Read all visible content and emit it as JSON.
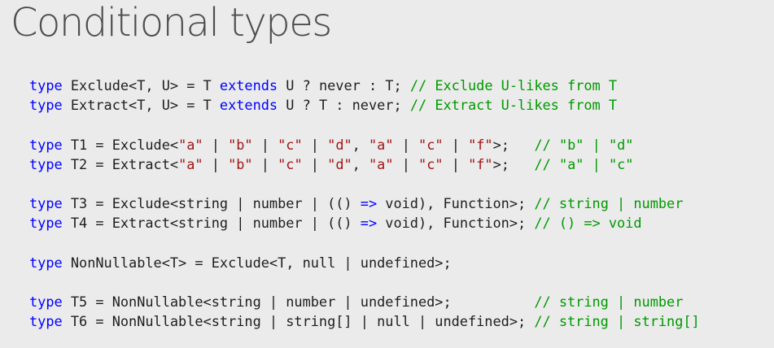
{
  "slide": {
    "title": "Conditional types"
  },
  "code_groups": [
    [
      [
        {
          "t": "type",
          "c": "kw"
        },
        {
          "t": " Exclude<T, U> = T "
        },
        {
          "t": "extends",
          "c": "kw"
        },
        {
          "t": " U ? never : T; "
        },
        {
          "t": "// Exclude U-likes from T",
          "c": "cmt"
        }
      ],
      [
        {
          "t": "type",
          "c": "kw"
        },
        {
          "t": " Extract<T, U> = T "
        },
        {
          "t": "extends",
          "c": "kw"
        },
        {
          "t": " U ? T : never; "
        },
        {
          "t": "// Extract U-likes from T",
          "c": "cmt"
        }
      ]
    ],
    [
      [
        {
          "t": "type",
          "c": "kw"
        },
        {
          "t": " T1 = Exclude<"
        },
        {
          "t": "\"a\"",
          "c": "str"
        },
        {
          "t": " | "
        },
        {
          "t": "\"b\"",
          "c": "str"
        },
        {
          "t": " | "
        },
        {
          "t": "\"c\"",
          "c": "str"
        },
        {
          "t": " | "
        },
        {
          "t": "\"d\"",
          "c": "str"
        },
        {
          "t": ", "
        },
        {
          "t": "\"a\"",
          "c": "str"
        },
        {
          "t": " | "
        },
        {
          "t": "\"c\"",
          "c": "str"
        },
        {
          "t": " | "
        },
        {
          "t": "\"f\"",
          "c": "str"
        },
        {
          "t": ">;   "
        },
        {
          "t": "// \"b\" | \"d\"",
          "c": "cmt"
        }
      ],
      [
        {
          "t": "type",
          "c": "kw"
        },
        {
          "t": " T2 = Extract<"
        },
        {
          "t": "\"a\"",
          "c": "str"
        },
        {
          "t": " | "
        },
        {
          "t": "\"b\"",
          "c": "str"
        },
        {
          "t": " | "
        },
        {
          "t": "\"c\"",
          "c": "str"
        },
        {
          "t": " | "
        },
        {
          "t": "\"d\"",
          "c": "str"
        },
        {
          "t": ", "
        },
        {
          "t": "\"a\"",
          "c": "str"
        },
        {
          "t": " | "
        },
        {
          "t": "\"c\"",
          "c": "str"
        },
        {
          "t": " | "
        },
        {
          "t": "\"f\"",
          "c": "str"
        },
        {
          "t": ">;   "
        },
        {
          "t": "// \"a\" | \"c\"",
          "c": "cmt"
        }
      ]
    ],
    [
      [
        {
          "t": "type",
          "c": "kw"
        },
        {
          "t": " T3 = Exclude<string | number | (() "
        },
        {
          "t": "=>",
          "c": "kw"
        },
        {
          "t": " void), Function>; "
        },
        {
          "t": "// string | number",
          "c": "cmt"
        }
      ],
      [
        {
          "t": "type",
          "c": "kw"
        },
        {
          "t": " T4 = Extract<string | number | (() "
        },
        {
          "t": "=>",
          "c": "kw"
        },
        {
          "t": " void), Function>; "
        },
        {
          "t": "// () => void",
          "c": "cmt"
        }
      ]
    ],
    [
      [
        {
          "t": "type",
          "c": "kw"
        },
        {
          "t": " NonNullable<T> = Exclude<T, null | undefined>;"
        }
      ]
    ],
    [
      [
        {
          "t": "type",
          "c": "kw"
        },
        {
          "t": " T5 = NonNullable<string | number | undefined>;          "
        },
        {
          "t": "// string | number",
          "c": "cmt"
        }
      ],
      [
        {
          "t": "type",
          "c": "kw"
        },
        {
          "t": " T6 = NonNullable<string | string[] | null | undefined>; "
        },
        {
          "t": "// string | string[]",
          "c": "cmt"
        }
      ]
    ]
  ]
}
